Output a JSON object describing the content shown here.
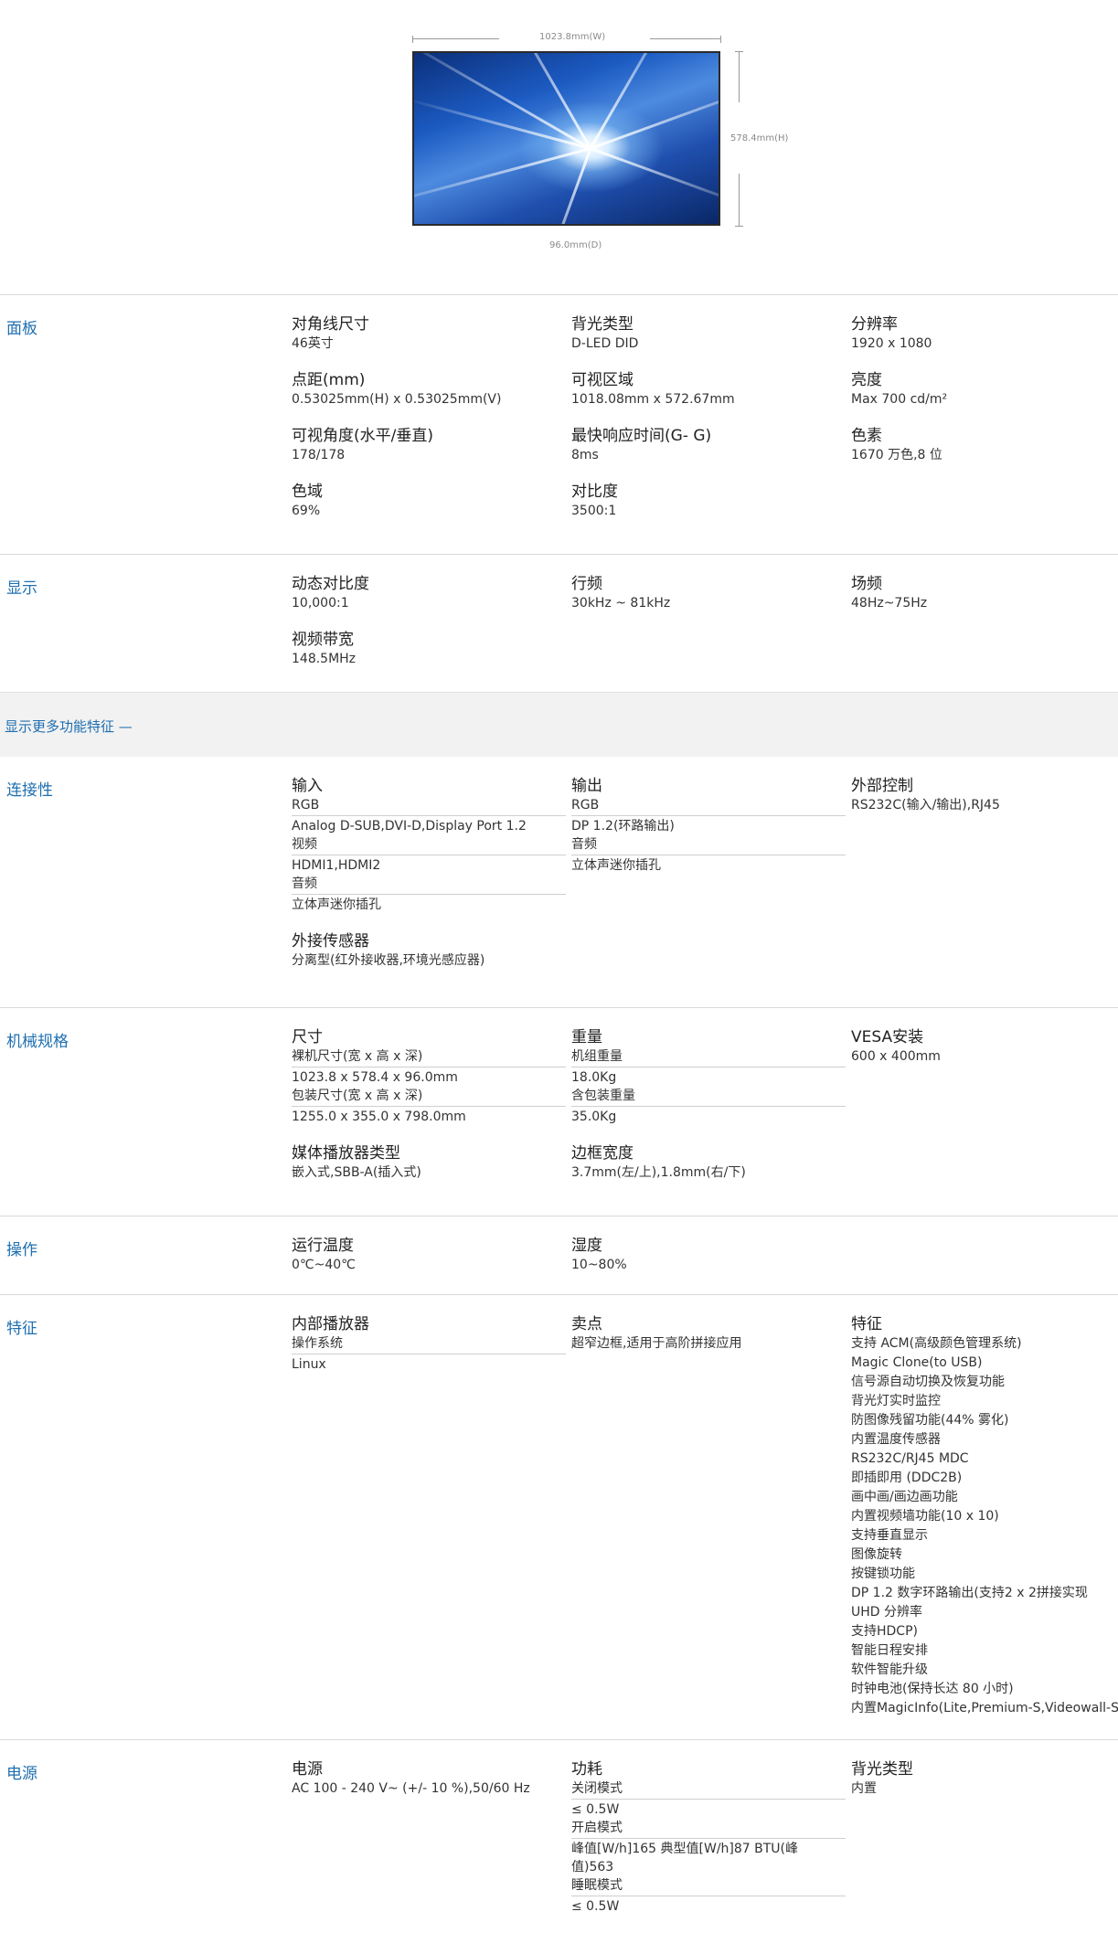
{
  "dimensions": {
    "width": "1023.8mm(W)",
    "height": "578.4mm(H)",
    "depth": "96.0mm(D)"
  },
  "panel": {
    "title": "面板",
    "specs": [
      {
        "label": "对角线尺寸",
        "value": "46英寸"
      },
      {
        "label": "背光类型",
        "value": "D-LED DID"
      },
      {
        "label": "分辨率",
        "value": "1920 x 1080"
      },
      {
        "label": "点距(mm)",
        "value": "0.53025mm(H) x 0.53025mm(V)"
      },
      {
        "label": "可视区域",
        "value": "1018.08mm x 572.67mm"
      },
      {
        "label": "亮度",
        "value": "Max 700 cd/m²"
      },
      {
        "label": "可视角度(水平/垂直)",
        "value": "178/178"
      },
      {
        "label": "最快响应时间(G- G)",
        "value": "8ms"
      },
      {
        "label": "色素",
        "value": "1670 万色,8 位"
      },
      {
        "label": "色域",
        "value": "69%"
      },
      {
        "label": "对比度",
        "value": "3500:1"
      }
    ]
  },
  "display": {
    "title": "显示",
    "specs": [
      {
        "label": "动态对比度",
        "value": "10,000:1"
      },
      {
        "label": "行频",
        "value": "30kHz ~ 81kHz"
      },
      {
        "label": "场频",
        "value": "48Hz~75Hz"
      },
      {
        "label": "视频带宽",
        "value": "148.5MHz"
      }
    ]
  },
  "more_link": "显示更多功能特征 —",
  "connectivity": {
    "title": "连接性",
    "input": {
      "label": "输入",
      "rgb_label": "RGB",
      "rgb_value": "Analog D-SUB,DVI-D,Display Port 1.2",
      "video_label": "视频",
      "video_value": "HDMI1,HDMI2",
      "audio_label": "音频",
      "audio_value": "立体声迷你插孔"
    },
    "output": {
      "label": "输出",
      "rgb_label": "RGB",
      "rgb_value": "DP 1.2(环路输出)",
      "audio_label": "音频",
      "audio_value": "立体声迷你插孔"
    },
    "control": {
      "label": "外部控制",
      "value": "RS232C(输入/输出),RJ45"
    },
    "sensor": {
      "label": "外接传感器",
      "value": "分离型(红外接收器,环境光感应器)"
    }
  },
  "mechanical": {
    "title": "机械规格",
    "size": {
      "label": "尺寸",
      "bare_label": "裸机尺寸(宽 x 高 x 深)",
      "bare_value": "1023.8 x 578.4 x 96.0mm",
      "pkg_label": "包装尺寸(宽 x 高 x 深)",
      "pkg_value": "1255.0 x 355.0 x 798.0mm"
    },
    "weight": {
      "label": "重量",
      "set_label": "机组重量",
      "set_value": "18.0Kg",
      "pkg_label": "含包装重量",
      "pkg_value": "35.0Kg"
    },
    "vesa": {
      "label": "VESA安装",
      "value": "600 x 400mm"
    },
    "player": {
      "label": "媒体播放器类型",
      "value": "嵌入式,SBB-A(插入式)"
    },
    "bezel": {
      "label": "边框宽度",
      "value": "3.7mm(左/上),1.8mm(右/下)"
    }
  },
  "operation": {
    "title": "操作",
    "temp": {
      "label": "运行温度",
      "value": "0℃~40℃"
    },
    "humidity": {
      "label": "湿度",
      "value": "10~80%"
    }
  },
  "features": {
    "title": "特征",
    "player": {
      "label": "内部播放器",
      "os_label": "操作系统",
      "os_value": "Linux"
    },
    "selling": {
      "label": "卖点",
      "value": "超窄边框,适用于高阶拼接应用"
    },
    "feature_label": "特征",
    "feature_list": [
      "支持 ACM(高级颜色管理系统)",
      "Magic Clone(to USB)",
      "信号源自动切换及恢复功能",
      "背光灯实时监控",
      "防图像残留功能(44% 雾化)",
      "内置温度传感器",
      "RS232C/RJ45 MDC",
      "即插即用 (DDC2B)",
      "画中画/画边画功能",
      "内置视频墙功能(10 x 10)",
      "支持垂直显示",
      "图像旋转",
      "按键锁功能",
      "DP 1.2 数字环路输出(支持2 x 2拼接实现",
      "UHD 分辨率",
      "支持HDCP)",
      "智能日程安排",
      "软件智能升级",
      "时钟电池(保持长达 80 小时)",
      "内置MagicInfo(Lite,Premium-S,Videowall-S)"
    ]
  },
  "power": {
    "title": "电源",
    "supply": {
      "label": "电源",
      "value": "AC 100 - 240 V~ (+/- 10 %),50/60 Hz"
    },
    "consumption": {
      "label": "功耗",
      "off_label": "关闭模式",
      "off_value": "≤ 0.5W",
      "on_label": "开启模式",
      "on_value_1": "峰值[W/h]165 典型值[W/h]87 BTU(峰",
      "on_value_2": "值)563",
      "sleep_label": "睡眠模式",
      "sleep_value": "≤ 0.5W"
    },
    "backlight": {
      "label": "背光类型",
      "value": "内置"
    }
  }
}
